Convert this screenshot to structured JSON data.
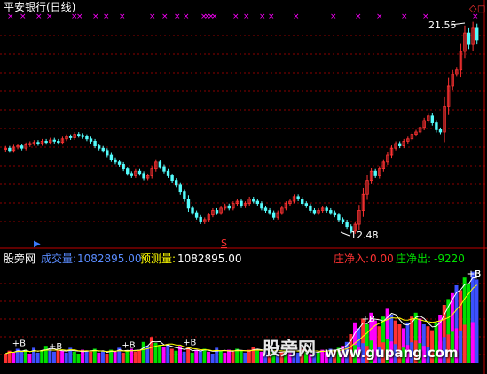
{
  "main_panel": {
    "title": "平安银行(日线)",
    "high_label": "21.55",
    "low_label": "12.48",
    "signal_marker": "S",
    "title_color": "#ffffff"
  },
  "indicator_panel": {
    "indicator_name": "股旁网",
    "volume_label": "成交量:",
    "volume_value": "1082895.00",
    "forecast_label": "预测量:",
    "forecast_value": "1082895.00",
    "inflow_label": "庄净入:",
    "inflow_value": "0.00",
    "outflow_label": "庄净出:",
    "outflow_value": "-9220",
    "buy_marker": "+B"
  },
  "watermark": {
    "logo_text": "股旁网",
    "url_text": "www.gupang.com"
  },
  "colors": {
    "up": "#ff3232",
    "down": "#54fcfc",
    "grid": "#8c0000",
    "cross_marker": "#ff00ff",
    "volume_label": "#5a8cff",
    "forecast_label": "#ffff00",
    "inflow": "#ff3232",
    "outflow": "#00e000"
  },
  "chart_data": {
    "type": "candlestick",
    "price_range": [
      12.48,
      21.55
    ],
    "closes": [
      16.2,
      16.1,
      16.25,
      16.3,
      16.2,
      16.35,
      16.4,
      16.45,
      16.4,
      16.5,
      16.45,
      16.55,
      16.5,
      16.45,
      16.6,
      16.7,
      16.65,
      16.8,
      16.75,
      16.7,
      16.6,
      16.5,
      16.3,
      16.2,
      16.1,
      15.9,
      15.7,
      15.6,
      15.5,
      15.3,
      15.1,
      15.0,
      15.2,
      15.1,
      14.9,
      15.0,
      15.3,
      15.6,
      15.4,
      15.2,
      15.0,
      14.8,
      14.6,
      14.3,
      14.0,
      13.6,
      13.4,
      13.2,
      13.0,
      13.1,
      13.3,
      13.5,
      13.4,
      13.6,
      13.7,
      13.6,
      13.8,
      13.9,
      13.7,
      13.8,
      14.0,
      13.9,
      13.8,
      13.6,
      13.5,
      13.4,
      13.2,
      13.4,
      13.6,
      13.8,
      13.9,
      14.1,
      14.0,
      13.8,
      13.7,
      13.5,
      13.4,
      13.5,
      13.6,
      13.5,
      13.4,
      13.3,
      13.1,
      13.0,
      12.8,
      12.6,
      12.9,
      13.5,
      14.2,
      14.8,
      15.2,
      15.0,
      15.3,
      15.6,
      15.9,
      16.2,
      16.4,
      16.3,
      16.5,
      16.6,
      16.8,
      16.9,
      17.1,
      17.4,
      17.6,
      17.3,
      17.0,
      16.9,
      18.0,
      18.9,
      19.4,
      19.6,
      20.4,
      21.2,
      20.7,
      21.4,
      20.9
    ],
    "volumes": [
      0.1,
      0.13,
      0.11,
      0.15,
      0.12,
      0.14,
      0.1,
      0.16,
      0.11,
      0.13,
      0.18,
      0.15,
      0.12,
      0.14,
      0.13,
      0.11,
      0.16,
      0.12,
      0.1,
      0.14,
      0.13,
      0.12,
      0.15,
      0.11,
      0.13,
      0.1,
      0.14,
      0.12,
      0.16,
      0.11,
      0.13,
      0.15,
      0.12,
      0.14,
      0.22,
      0.18,
      0.27,
      0.21,
      0.19,
      0.17,
      0.2,
      0.15,
      0.13,
      0.18,
      0.12,
      0.16,
      0.11,
      0.14,
      0.13,
      0.15,
      0.12,
      0.1,
      0.16,
      0.13,
      0.11,
      0.14,
      0.12,
      0.15,
      0.13,
      0.11,
      0.14,
      0.17,
      0.13,
      0.12,
      0.15,
      0.11,
      0.13,
      0.1,
      0.12,
      0.14,
      0.16,
      0.13,
      0.11,
      0.15,
      0.12,
      0.1,
      0.13,
      0.11,
      0.14,
      0.12,
      0.15,
      0.13,
      0.16,
      0.18,
      0.22,
      0.3,
      0.42,
      0.36,
      0.46,
      0.4,
      0.52,
      0.44,
      0.38,
      0.48,
      0.56,
      0.5,
      0.44,
      0.4,
      0.36,
      0.42,
      0.48,
      0.52,
      0.46,
      0.4,
      0.38,
      0.34,
      0.42,
      0.5,
      0.6,
      0.66,
      0.72,
      0.8,
      0.75,
      0.88,
      0.82,
      0.94,
      0.86
    ],
    "buy_signals": [
      3,
      12,
      30,
      45,
      89,
      118,
      122,
      147,
      150
    ]
  }
}
